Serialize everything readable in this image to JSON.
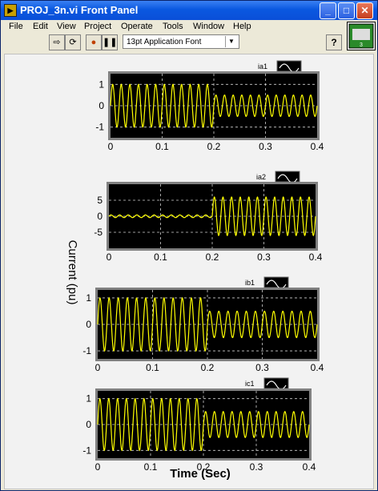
{
  "window": {
    "title": "PROJ_3n.vi Front Panel",
    "icon": "labview-vi-icon",
    "controls": {
      "minimize": "_",
      "maximize": "□",
      "close": "✕"
    }
  },
  "menu": [
    "File",
    "Edit",
    "View",
    "Project",
    "Operate",
    "Tools",
    "Window",
    "Help"
  ],
  "toolbar": {
    "run_icon": "run-arrow-icon",
    "run_continuous_icon": "run-continuously-icon",
    "abort_icon": "abort-icon",
    "pause_icon": "pause-icon",
    "font": "13pt Application Font",
    "help": "?"
  },
  "panel": {
    "ylabel": "Current (pu)",
    "xlabel": "Time (Sec)"
  },
  "colors": {
    "plot_bg": "#000000",
    "trace": "#ffff00",
    "grid": "#d0d0d0",
    "titlebar": "#0a58e0"
  },
  "chart_data": [
    {
      "type": "line",
      "legend": "ia1",
      "x_ticks": [
        "0",
        "0.1",
        "0.2",
        "0.3",
        "0.4"
      ],
      "y_ticks": [
        "1",
        "0",
        "-1"
      ],
      "xlim": [
        0,
        0.4
      ],
      "ylim": [
        -1.5,
        1.5
      ],
      "series": [
        {
          "frequency_hz": 60,
          "segments": [
            {
              "t_start": 0,
              "t_end": 0.2,
              "amplitude": 1.0
            },
            {
              "t_start": 0.2,
              "t_end": 0.4,
              "amplitude": 0.5
            }
          ]
        }
      ]
    },
    {
      "type": "line",
      "legend": "ia2",
      "x_ticks": [
        "0",
        "0.1",
        "0.2",
        "0.3",
        "0.4"
      ],
      "y_ticks": [
        "5",
        "0",
        "-5"
      ],
      "xlim": [
        0,
        0.4
      ],
      "ylim": [
        -10,
        10
      ],
      "series": [
        {
          "frequency_hz": 60,
          "segments": [
            {
              "t_start": 0,
              "t_end": 0.2,
              "amplitude": 0.4
            },
            {
              "t_start": 0.2,
              "t_end": 0.4,
              "amplitude": 6.0
            }
          ]
        }
      ]
    },
    {
      "type": "line",
      "legend": "ib1",
      "x_ticks": [
        "0",
        "0.1",
        "0.2",
        "0.3",
        "0.4"
      ],
      "y_ticks": [
        "1",
        "0",
        "-1"
      ],
      "xlim": [
        0,
        0.4
      ],
      "ylim": [
        -1.3,
        1.3
      ],
      "series": [
        {
          "frequency_hz": 60,
          "segments": [
            {
              "t_start": 0,
              "t_end": 0.2,
              "amplitude": 1.0
            },
            {
              "t_start": 0.2,
              "t_end": 0.4,
              "amplitude": 0.5
            }
          ]
        }
      ]
    },
    {
      "type": "line",
      "legend": "ic1",
      "x_ticks": [
        "0",
        "0.1",
        "0.2",
        "0.3",
        "0.4"
      ],
      "y_ticks": [
        "1",
        "0",
        "-1"
      ],
      "xlim": [
        0,
        0.4
      ],
      "ylim": [
        -1.3,
        1.3
      ],
      "series": [
        {
          "frequency_hz": 60,
          "segments": [
            {
              "t_start": 0,
              "t_end": 0.2,
              "amplitude": 1.0
            },
            {
              "t_start": 0.2,
              "t_end": 0.4,
              "amplitude": 0.5
            }
          ]
        }
      ]
    }
  ]
}
